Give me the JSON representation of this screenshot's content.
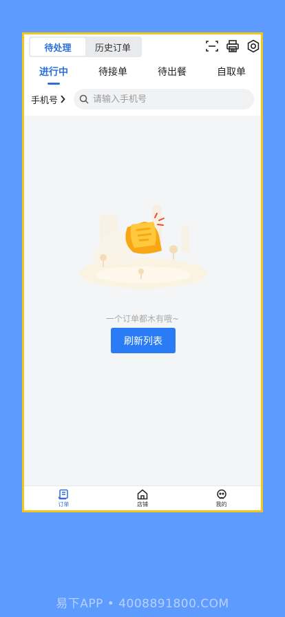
{
  "header": {
    "segments": [
      {
        "label": "待处理",
        "active": true
      },
      {
        "label": "历史订单",
        "active": false
      }
    ],
    "icons": [
      "scan-icon",
      "printer-icon",
      "settings-icon"
    ]
  },
  "tabs": [
    {
      "label": "进行中",
      "active": true
    },
    {
      "label": "待接单",
      "active": false
    },
    {
      "label": "待出餐",
      "active": false
    },
    {
      "label": "自取单",
      "active": false
    }
  ],
  "search": {
    "label": "手机号",
    "placeholder": "请输入手机号",
    "value": ""
  },
  "empty": {
    "text": "一个订单都木有哦~",
    "button": "刷新列表"
  },
  "bottom_nav": [
    {
      "label": "订单",
      "icon": "order-icon",
      "active": true
    },
    {
      "label": "店铺",
      "icon": "store-icon",
      "active": false
    },
    {
      "label": "我的",
      "icon": "profile-icon",
      "active": false
    }
  ],
  "watermark": "易下APP • 4008891800.COM",
  "colors": {
    "accent": "#2a7cf6",
    "background": "#5e9bff",
    "frame": "#f5c518"
  }
}
